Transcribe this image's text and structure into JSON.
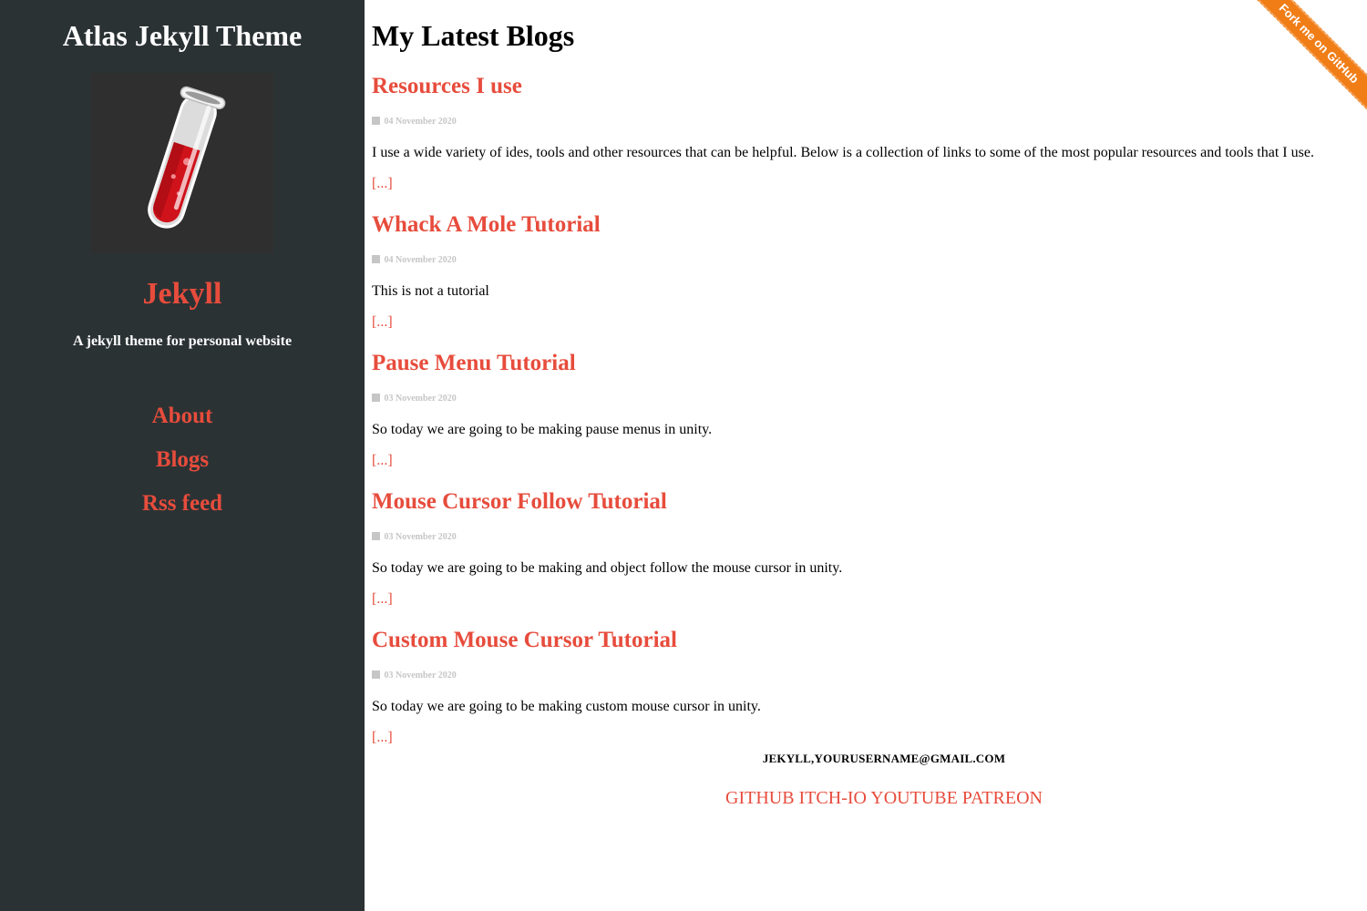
{
  "sidebar": {
    "site_title": "Atlas Jekyll Theme",
    "author_name": "Jekyll",
    "tagline": "A jekyll theme for personal website",
    "nav": [
      {
        "label": "About"
      },
      {
        "label": "Blogs"
      },
      {
        "label": "Rss feed"
      }
    ]
  },
  "main": {
    "heading": "My Latest Blogs",
    "posts": [
      {
        "title": "Resources I use",
        "date": "04 November 2020",
        "excerpt": "I use a wide variety of ides, tools and other resources that can be helpful. Below is a collection of links to some of the most popular resources and tools that I use.",
        "more": "[...]"
      },
      {
        "title": "Whack A Mole Tutorial",
        "date": "04 November 2020",
        "excerpt": "This is not a tutorial",
        "more": "[...]"
      },
      {
        "title": "Pause Menu Tutorial",
        "date": "03 November 2020",
        "excerpt": "So today we are going to be making pause menus in unity.",
        "more": "[...]"
      },
      {
        "title": "Mouse Cursor Follow Tutorial",
        "date": "03 November 2020",
        "excerpt": "So today we are going to be making and object follow the mouse cursor in unity.",
        "more": "[...]"
      },
      {
        "title": "Custom Mouse Cursor Tutorial",
        "date": "03 November 2020",
        "excerpt": "So today we are going to be making custom mouse cursor in unity.",
        "more": "[...]"
      }
    ]
  },
  "footer": {
    "email": "JEKYLL,YOURUSERNAME@GMAIL.COM",
    "links": [
      "GITHUB",
      "ITCH-IO",
      "YOUTUBE",
      "PATREON"
    ]
  },
  "ribbon": {
    "label": "Fork me on GitHub"
  },
  "colors": {
    "sidebar_bg": "#2b3234",
    "accent": "#e74c3c",
    "ribbon": "#f07d16",
    "date": "#c6c6c6"
  },
  "icons": {
    "avatar": "test-tube-icon",
    "date": "calendar-icon"
  }
}
